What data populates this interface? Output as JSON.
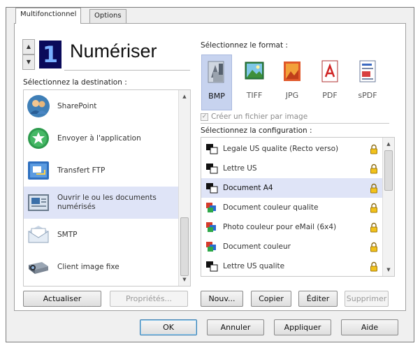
{
  "tabs": [
    {
      "label": "Multifonctionnel",
      "active": true
    },
    {
      "label": "Options",
      "active": false
    }
  ],
  "counter": {
    "value": "1"
  },
  "title": "Numériser",
  "destination": {
    "label": "Sélectionnez la destination :",
    "items": [
      {
        "label": "SharePoint",
        "icon": "sharepoint-icon"
      },
      {
        "label": "Envoyer à l'application",
        "icon": "send-to-app-icon"
      },
      {
        "label": "Transfert FTP",
        "icon": "ftp-icon"
      },
      {
        "label_line1": "Ouvrir le ou les documents",
        "label_line2": "numérisés",
        "icon": "open-documents-icon",
        "selected": true
      },
      {
        "label": "SMTP",
        "icon": "smtp-icon"
      },
      {
        "label": "Client image fixe",
        "icon": "still-image-client-icon"
      }
    ],
    "refresh_button": "Actualiser",
    "properties_button": "Propriétés..."
  },
  "format": {
    "label": "Sélectionnez le format :",
    "items": [
      {
        "label": "BMP",
        "selected": true
      },
      {
        "label": "TIFF"
      },
      {
        "label": "JPG"
      },
      {
        "label": "PDF"
      },
      {
        "label": "sPDF"
      }
    ],
    "checkbox_label": "Créer un fichier par image"
  },
  "configuration": {
    "label": "Sélectionnez la configuration :",
    "items": [
      {
        "label": "Legale US qualite (Recto verso)",
        "icon": "bw-config-icon"
      },
      {
        "label": "Lettre US",
        "icon": "bw-config-icon"
      },
      {
        "label": "Document A4",
        "icon": "bw-config-icon",
        "selected": true
      },
      {
        "label": "Document couleur qualite",
        "icon": "color-config-icon"
      },
      {
        "label": "Photo couleur pour eMail (6x4)",
        "icon": "color-config-icon"
      },
      {
        "label": "Document couleur",
        "icon": "color-config-icon"
      },
      {
        "label": "Lettre US qualite",
        "icon": "bw-config-icon"
      }
    ],
    "new_button": "Nouv...",
    "copy_button": "Copier",
    "edit_button": "Éditer",
    "delete_button": "Supprimer"
  },
  "footer": {
    "ok": "OK",
    "cancel": "Annuler",
    "apply": "Appliquer",
    "help": "Aide"
  },
  "colors": {
    "selection": "#dfe4f7",
    "format_selection": "#c7d3ef",
    "lcd_bg": "#0a0a5a"
  }
}
